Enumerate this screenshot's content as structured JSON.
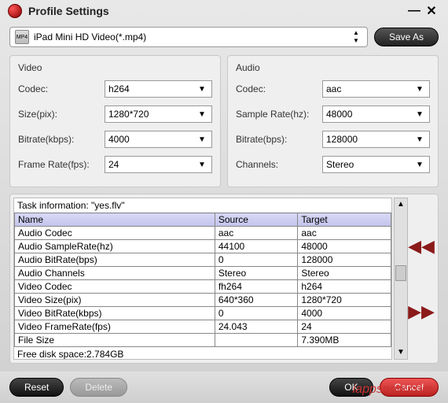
{
  "title": "Profile Settings",
  "profile": {
    "label": "iPad Mini HD Video(*.mp4)",
    "fmt": "MP4"
  },
  "saveAs": "Save As",
  "video": {
    "heading": "Video",
    "fields": [
      {
        "label": "Codec:",
        "value": "h264"
      },
      {
        "label": "Size(pix):",
        "value": "1280*720"
      },
      {
        "label": "Bitrate(kbps):",
        "value": "4000"
      },
      {
        "label": "Frame Rate(fps):",
        "value": "24"
      }
    ]
  },
  "audio": {
    "heading": "Audio",
    "fields": [
      {
        "label": "Codec:",
        "value": "aac"
      },
      {
        "label": "Sample Rate(hz):",
        "value": "48000"
      },
      {
        "label": "Bitrate(bps):",
        "value": "128000"
      },
      {
        "label": "Channels:",
        "value": "Stereo"
      }
    ]
  },
  "task": {
    "title": "Task information: \"yes.flv\"",
    "headers": [
      "Name",
      "Source",
      "Target"
    ],
    "rows": [
      [
        "Audio Codec",
        "aac",
        "aac"
      ],
      [
        "Audio SampleRate(hz)",
        "44100",
        "48000"
      ],
      [
        "Audio BitRate(bps)",
        "0",
        "128000"
      ],
      [
        "Audio Channels",
        "Stereo",
        "Stereo"
      ],
      [
        "Video Codec",
        "fh264",
        "h264"
      ],
      [
        "Video Size(pix)",
        "640*360",
        "1280*720"
      ],
      [
        "Video BitRate(kbps)",
        "0",
        "4000"
      ],
      [
        "Video FrameRate(fps)",
        "24.043",
        "24"
      ],
      [
        "File Size",
        "",
        "7.390MB"
      ]
    ],
    "freeDisk": "Free disk space:2.784GB"
  },
  "footer": {
    "reset": "Reset",
    "delete": "Delete",
    "ok": "OK",
    "cancel": "Cancel"
  },
  "watermark": "iappsnow.com"
}
